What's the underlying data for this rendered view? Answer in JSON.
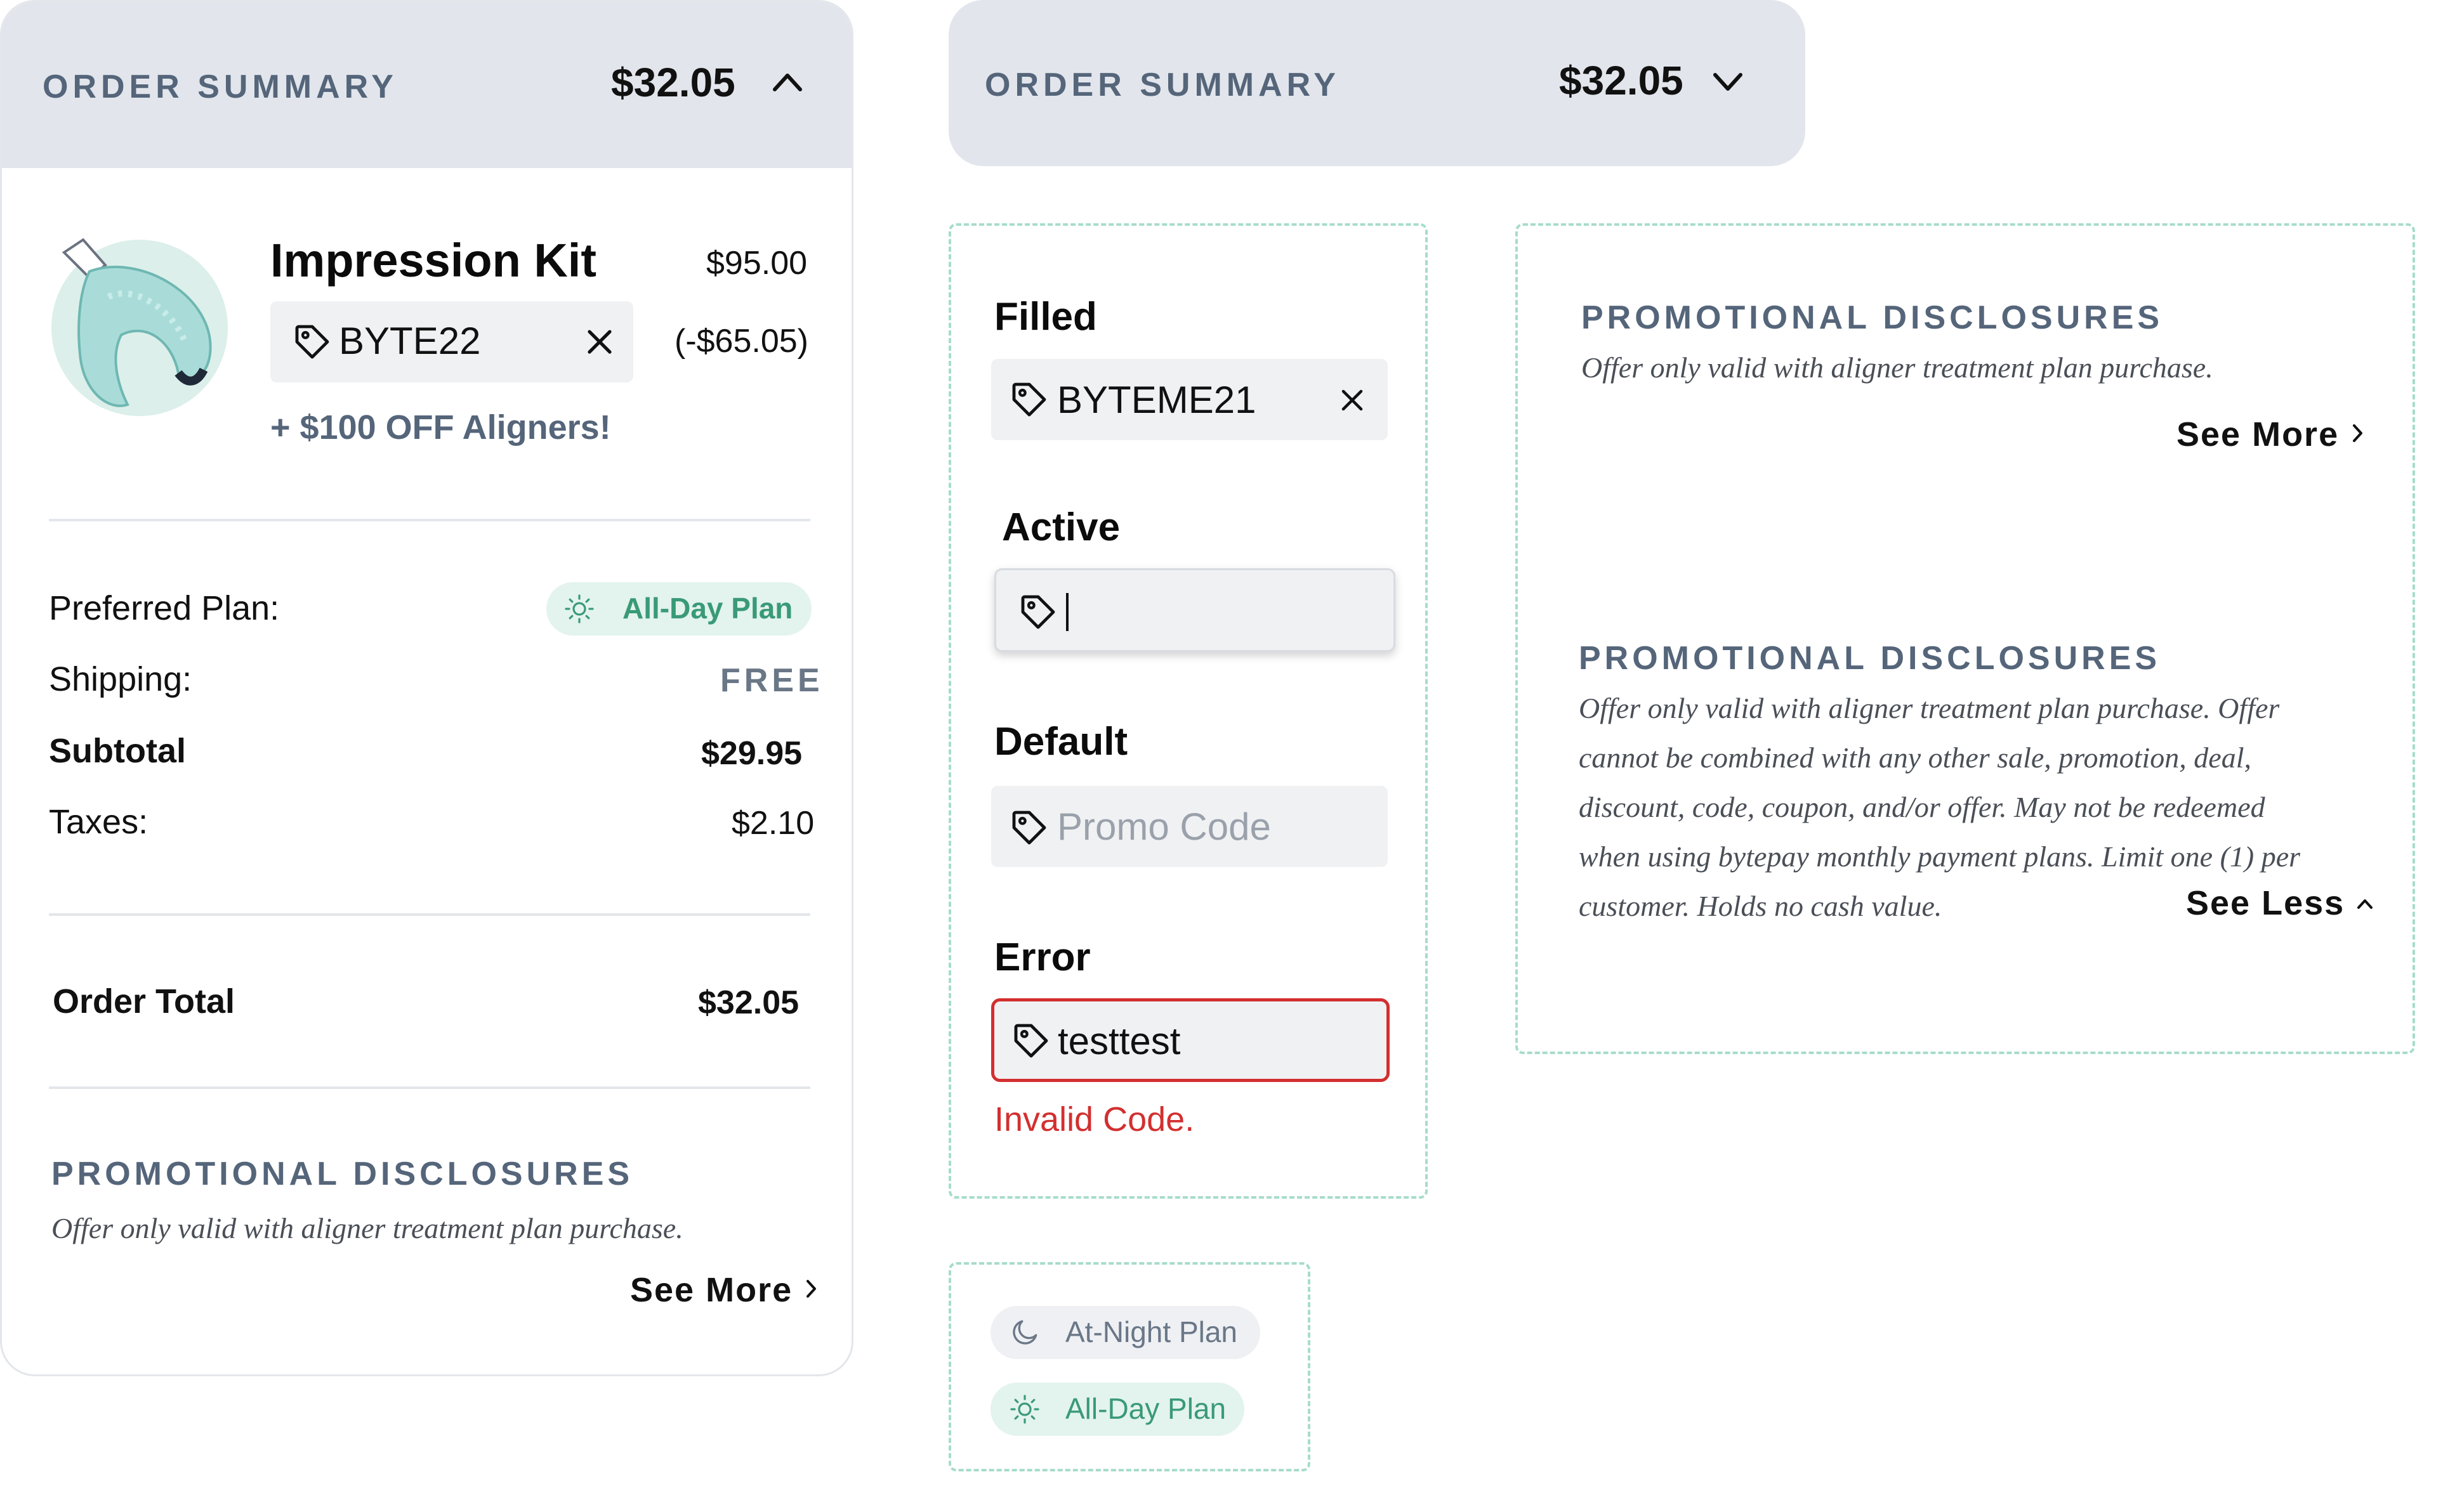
{
  "order_summary": {
    "title": "ORDER SUMMARY",
    "total": "$32.05",
    "product": {
      "name": "Impression Kit",
      "price": "$95.00",
      "discount": "(-$65.05)",
      "promo_code": "BYTE22",
      "promo_offer": "+ $100 OFF Aligners!"
    },
    "rows": {
      "preferred_plan_label": "Preferred Plan:",
      "preferred_plan_value": "All-Day Plan",
      "shipping_label": "Shipping:",
      "shipping_value": "FREE",
      "subtotal_label": "Subtotal",
      "subtotal_value": "$29.95",
      "taxes_label": "Taxes:",
      "taxes_value": "$2.10",
      "order_total_label": "Order Total",
      "order_total_value": "$32.05"
    },
    "disclosures": {
      "title": "PROMOTIONAL DISCLOSURES",
      "short_text": "Offer only valid with aligner treatment plan purchase.",
      "see_more": "See More"
    }
  },
  "collapsed_summary": {
    "title": "ORDER SUMMARY",
    "total": "$32.05"
  },
  "promo_input_states": {
    "filled_label": "Filled",
    "filled_value": "BYTEME21",
    "active_label": "Active",
    "default_label": "Default",
    "default_placeholder": "Promo Code",
    "error_label": "Error",
    "error_value": "testtest",
    "error_message": "Invalid Code."
  },
  "plan_pills": {
    "night": "At-Night Plan",
    "day": "All-Day Plan"
  },
  "disclosure_variants": {
    "collapsed": {
      "title": "PROMOTIONAL DISCLOSURES",
      "text": "Offer only valid with aligner treatment plan purchase.",
      "see_more": "See More"
    },
    "expanded": {
      "title": "PROMOTIONAL DISCLOSURES",
      "lines": [
        "Offer only valid with aligner treatment plan purchase. Offer",
        "cannot be combined with any other sale, promotion, deal,",
        "discount, code, coupon, and/or offer. May not be redeemed",
        "when using bytepay monthly payment plans. Limit one (1) per",
        "customer. Holds no cash value."
      ],
      "see_less": "See Less"
    }
  },
  "icons": [
    "chevron-up-icon",
    "chevron-down-icon",
    "tag-icon",
    "close-icon",
    "sun-icon",
    "moon-icon",
    "chevron-right-icon"
  ],
  "colors": {
    "header_bg": "#e2e6ec",
    "muted_heading": "#55657a",
    "plan_green": "#3a9a78",
    "plan_green_bg": "#e3f3ee",
    "error_red": "#d32f2f",
    "dashed_frame": "#a7dccb"
  }
}
